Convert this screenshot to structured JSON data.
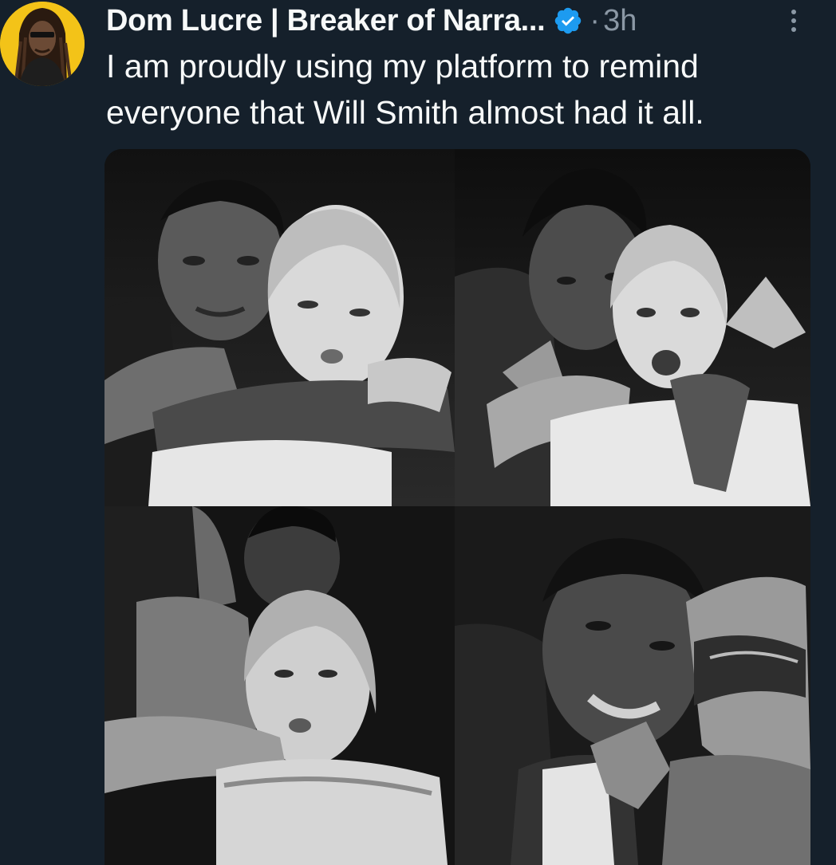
{
  "tweet": {
    "author": {
      "display_name": "Dom Lucre | Breaker of Narra...",
      "verified": true,
      "avatar_icon": "profile-avatar"
    },
    "separator": "·",
    "timestamp": "3h",
    "more_icon": "more-vertical-icon",
    "text_line_1": "I am proudly using my platform to remind",
    "text_line_2": "everyone that Will Smith almost had it all.",
    "media": {
      "layout": "2x2 grid",
      "style": "black and white"
    }
  },
  "colors": {
    "background": "#15202b",
    "primary_text": "#f7f9f9",
    "secondary_text": "#8b98a5",
    "verified_badge": "#1d9bf0",
    "avatar_ring": "#f3c318"
  }
}
